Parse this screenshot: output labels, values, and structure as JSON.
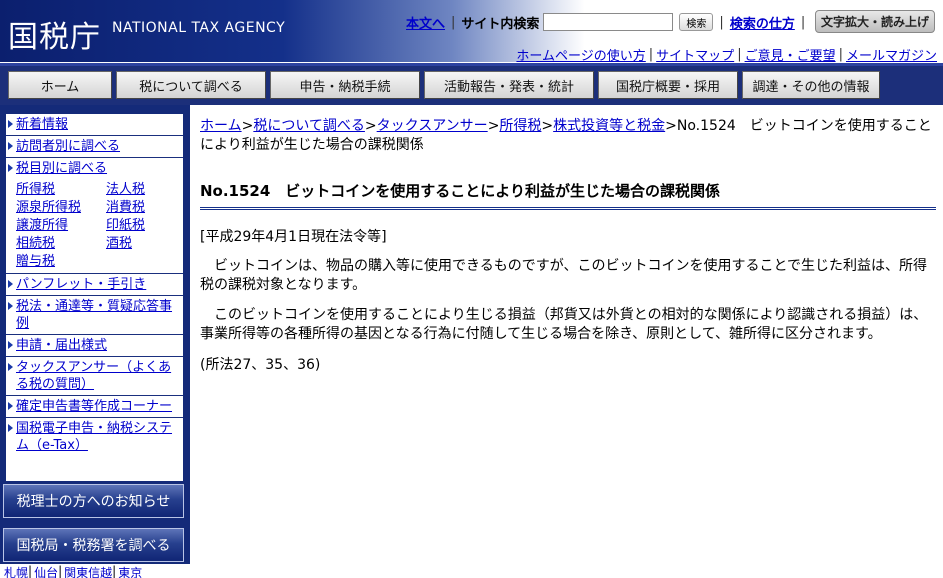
{
  "header": {
    "logo_jp": "国税庁",
    "logo_en": "NATIONAL TAX AGENCY",
    "skip_link": "本文へ",
    "search_label": "サイト内検索",
    "search_value": "",
    "search_button": "検索",
    "search_help": "検索の仕方",
    "fontsize_button": "文字拡大・読み上げ",
    "sub_links": [
      "ホームページの使い方",
      "サイトマップ",
      "ご意見・ご要望",
      "メールマガジン"
    ]
  },
  "gnav": [
    {
      "label": "ホーム"
    },
    {
      "label": "税について調べる"
    },
    {
      "label": "申告・納税手続"
    },
    {
      "label": "活動報告・発表・統計"
    },
    {
      "label": "国税庁概要・採用"
    },
    {
      "label": "調達・その他の情報"
    }
  ],
  "sidebar": {
    "items_top": [
      "新着情報",
      "訪問者別に調べる",
      "税目別に調べる"
    ],
    "taxes": [
      "所得税",
      "法人税",
      "源泉所得税",
      "消費税",
      "譲渡所得",
      "印紙税",
      "相続税",
      "酒税",
      "贈与税"
    ],
    "items_bottom": [
      "パンフレット・手引き",
      "税法・通達等・質疑応答事例",
      "申請・届出様式",
      "タックスアンサー（よくある税の質問）",
      "確定申告書等作成コーナー",
      "国税電子申告・納税システム（e-Tax）"
    ],
    "banner1": "税理士の方へのお知らせ",
    "banner2": "国税局・税務署を調べる",
    "region_links": [
      "札幌",
      "仙台",
      "関東信越",
      "東京"
    ]
  },
  "main": {
    "breadcrumb": [
      "ホーム",
      "税について調べる",
      "タックスアンサー",
      "所得税",
      "株式投資等と税金"
    ],
    "breadcrumb_current": "No.1524　ビットコインを使用することにより利益が生じた場合の課税関係",
    "title": "No.1524　ビットコインを使用することにより利益が生じた場合の課税関係",
    "law_date": "[平成29年4月1日現在法令等]",
    "paragraph1": "ビットコインは、物品の購入等に使用できるものですが、このビットコインを使用することで生じた利益は、所得税の課税対象となります。",
    "paragraph2": "このビットコインを使用することにより生じる損益（邦貨又は外貨との相対的な関係により認識される損益）は、事業所得等の各種所得の基因となる行為に付随して生じる場合を除き、原則として、雑所得に区分されます。",
    "reference": "(所法27、35、36)"
  },
  "colors": {
    "header_dark": "#0b1f6e",
    "nav_bg": "#1c2f7a",
    "link": "#0000cc"
  }
}
